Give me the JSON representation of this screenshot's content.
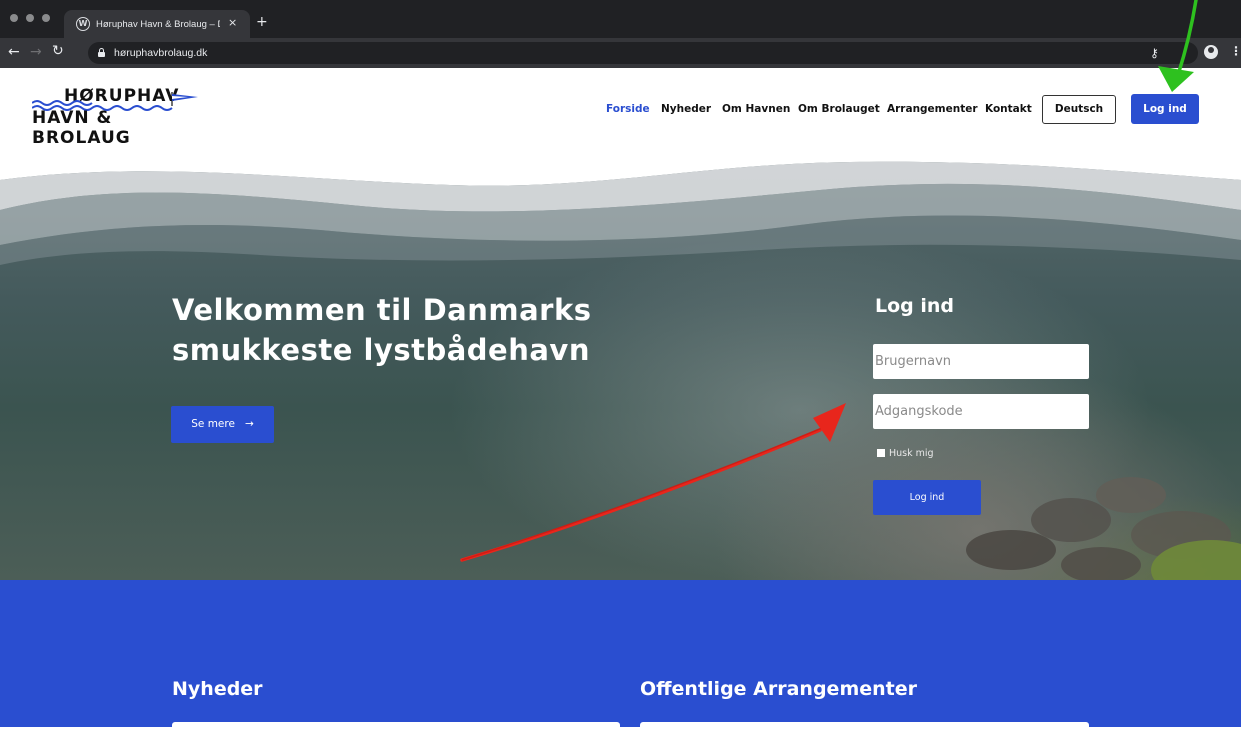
{
  "browser": {
    "tab_title": "Høruphav Havn & Brolaug – Da",
    "tab_close": "×",
    "new_tab": "+",
    "url": "høruphavbrolaug.dk",
    "back_icon": "arrow-left",
    "forward_icon": "arrow-right",
    "reload_icon": "reload",
    "lock_icon": "lock",
    "key_icon": "key",
    "profile_icon": "account-circle",
    "menu_icon": "kebab"
  },
  "logo": {
    "line1": "HØRUPHAV",
    "line2": "HAVN & BROLAUG"
  },
  "nav": {
    "items": [
      {
        "label": "Forside",
        "active": true
      },
      {
        "label": "Nyheder"
      },
      {
        "label": "Om Havnen"
      },
      {
        "label": "Om Brolauget"
      },
      {
        "label": "Arrangementer"
      },
      {
        "label": "Kontakt"
      }
    ],
    "deutsch_label": "Deutsch",
    "login_label": "Log ind"
  },
  "hero": {
    "title": "Velkommen til Danmarks smukkeste lystbådehavn",
    "cta_label": "Se mere",
    "cta_arrow": "→"
  },
  "login_form": {
    "title": "Log ind",
    "username_placeholder": "Brugernavn",
    "password_placeholder": "Adgangskode",
    "remember_label": "Husk mig",
    "submit_label": "Log ind"
  },
  "sections": {
    "news_title": "Nyheder",
    "events_title": "Offentlige Arrangementer"
  },
  "colors": {
    "brand_blue": "#2a4ed0",
    "annotation_red": "#e8261c",
    "annotation_green": "#2ec11f"
  }
}
